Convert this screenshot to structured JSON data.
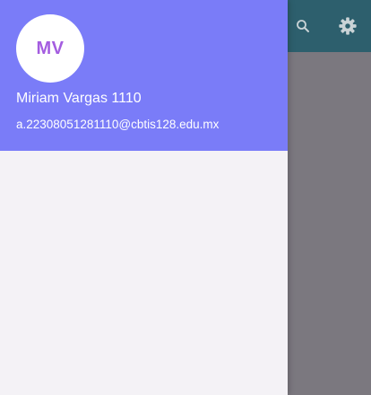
{
  "app_bar": {
    "actions": [
      {
        "icon": "search-icon"
      },
      {
        "icon": "gear-icon"
      }
    ],
    "background": "#2d5f6d"
  },
  "drawer": {
    "header": {
      "avatar_initials": "MV",
      "account_name": "Miriam Vargas 1110",
      "account_email": "a.22308051281110@cbtis128.edu.mx",
      "background": "#7a7cf8",
      "initials_color": "#a45de0"
    },
    "body_background": "#f4f2f6"
  },
  "scrim_color": "#7a777f"
}
